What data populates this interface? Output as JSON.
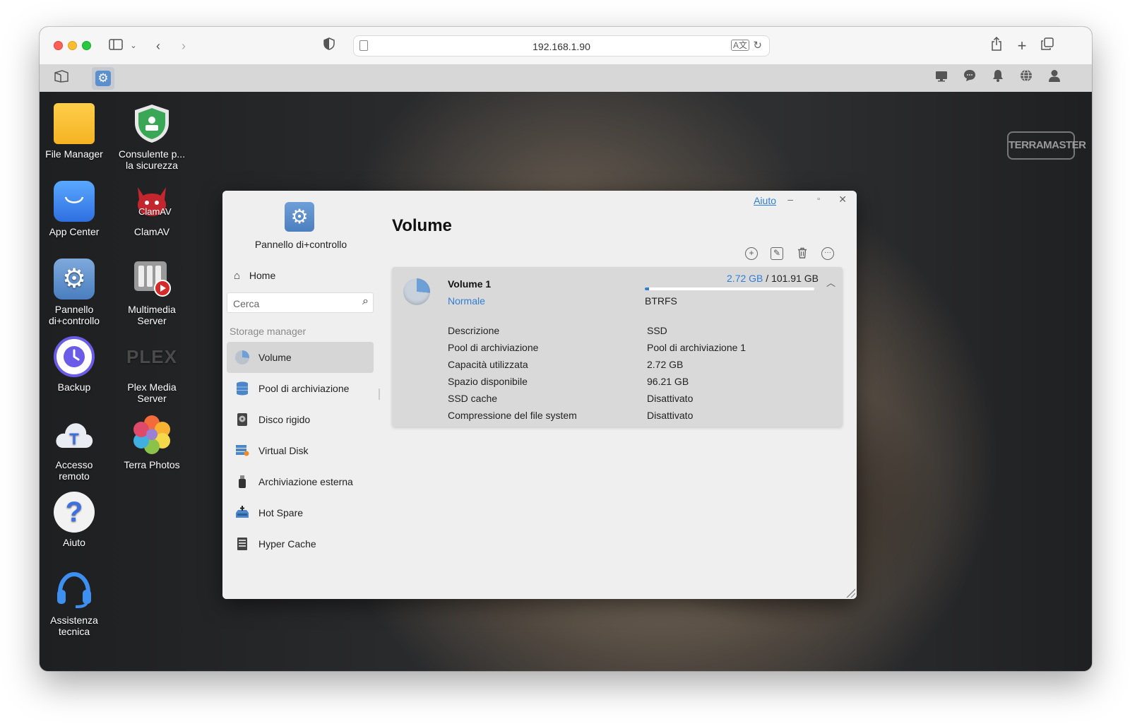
{
  "browser": {
    "url": "192.168.1.90"
  },
  "desktop_icons": [
    {
      "label_line1": "File Manager",
      "label_line2": ""
    },
    {
      "label_line1": "Consulente p...",
      "label_line2": "la sicurezza"
    },
    {
      "label_line1": "App Center",
      "label_line2": ""
    },
    {
      "label_line1": "ClamAV",
      "label_line2": ""
    },
    {
      "label_line1": "Pannello",
      "label_line2": "di+controllo"
    },
    {
      "label_line1": "Multimedia",
      "label_line2": "Server"
    },
    {
      "label_line1": "Backup",
      "label_line2": ""
    },
    {
      "label_line1": "Plex Media",
      "label_line2": "Server"
    },
    {
      "label_line1": "Accesso",
      "label_line2": "remoto"
    },
    {
      "label_line1": "Terra Photos",
      "label_line2": ""
    },
    {
      "label_line1": "Aiuto",
      "label_line2": ""
    },
    {
      "label_line1": "Assistenza",
      "label_line2": "tecnica"
    }
  ],
  "brand_logo": "TERRAMASTER",
  "plex_logo": "PLEX",
  "clamav_logo": "ClamAV",
  "app_window": {
    "app_title": "Pannello di+controllo",
    "help_link": "Aiuto",
    "home_label": "Home",
    "search_placeholder": "Cerca",
    "section_label": "Storage manager",
    "nav_items": [
      {
        "label": "Volume",
        "icon": "pie-chart-icon"
      },
      {
        "label": "Pool di archiviazione",
        "icon": "database-icon"
      },
      {
        "label": "Disco rigido",
        "icon": "hard-disk-icon"
      },
      {
        "label": "Virtual Disk",
        "icon": "virtual-disk-icon"
      },
      {
        "label": "Archiviazione esterna",
        "icon": "usb-drive-icon"
      },
      {
        "label": "Hot Spare",
        "icon": "hot-spare-icon"
      },
      {
        "label": "Hyper Cache",
        "icon": "cache-icon"
      }
    ],
    "page_title": "Volume",
    "volume": {
      "name": "Volume 1",
      "status": "Normale",
      "used": "2.72 GB",
      "separator": " / ",
      "total": "101.91 GB",
      "usage_fraction": 0.027,
      "filesystem": "BTRFS",
      "details": [
        {
          "label": "Descrizione",
          "value": "SSD"
        },
        {
          "label": "Pool di archiviazione",
          "value": "Pool di archiviazione 1"
        },
        {
          "label": "Capacità utilizzata",
          "value": "2.72 GB"
        },
        {
          "label": "Spazio disponibile",
          "value": "96.21 GB"
        },
        {
          "label": "SSD cache",
          "value": "Disattivato"
        },
        {
          "label": "Compressione del file system",
          "value": "Disattivato"
        }
      ]
    }
  },
  "colors": {
    "accent": "#2f7ed8",
    "active_nav_bg": "#d6d6d6"
  }
}
